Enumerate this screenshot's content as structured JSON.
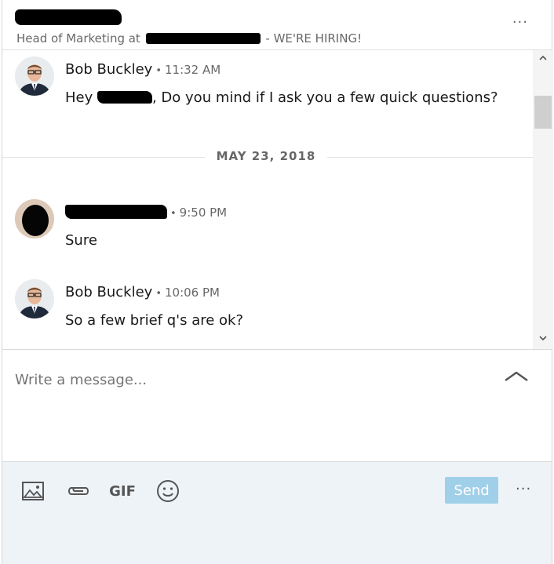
{
  "header": {
    "headline_prefix": "Head of Marketing at",
    "headline_suffix": "- WE'RE HIRING!",
    "more_label": "···"
  },
  "messages": [
    {
      "sender": "Bob Buckley",
      "time": "11:32 AM",
      "text_prefix": "Hey ",
      "text": ", Do you mind if I ask you a few quick questions?"
    },
    {
      "sender": "",
      "time": "9:50 PM",
      "text": "Sure"
    },
    {
      "sender": "Bob Buckley",
      "time": "10:06 PM",
      "text": "So a few brief q's are ok?"
    }
  ],
  "date_separator": "MAY 23, 2018",
  "compose": {
    "placeholder": "Write a message..."
  },
  "toolbar": {
    "gif_label": "GIF",
    "send_label": "Send",
    "more_label": "···"
  },
  "colors": {
    "send_disabled": "#a0cfe9",
    "toolbar_bg": "#eef3f8"
  }
}
